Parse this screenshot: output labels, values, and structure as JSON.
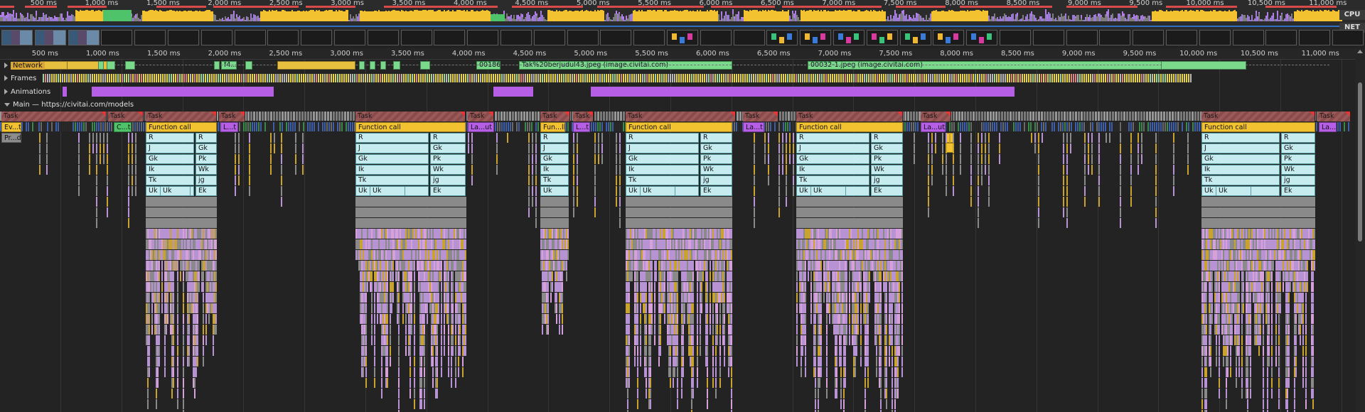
{
  "overview": {
    "ticks": [
      "500 ms",
      "1,000 ms",
      "1,500 ms",
      "2,000 ms",
      "2,500 ms",
      "3,000 ms",
      "3,500 ms",
      "4,000 ms",
      "4,500 ms",
      "5,000 ms",
      "5,500 ms",
      "6,000 ms",
      "6,500 ms",
      "7,000 ms",
      "7,500 ms",
      "8,000 ms",
      "8,500 ms",
      "9,000 ms",
      "9,500 ms",
      "10,000 ms",
      "10,500 ms",
      "11,000 ms"
    ],
    "cpu_label": "CPU",
    "net_label": "NET"
  },
  "timeline": {
    "ticks": [
      "500 ms",
      "1,000 ms",
      "1,500 ms",
      "2,000 ms",
      "2,500 ms",
      "3,000 ms",
      "3,500 ms",
      "4,000 ms",
      "4,500 ms",
      "5,000 ms",
      "5,500 ms",
      "6,000 ms",
      "6,500 ms",
      "7,000 ms",
      "7,500 ms",
      "8,000 ms",
      "8,500 ms",
      "9,000 ms",
      "9,500 ms",
      "10,000 ms",
      "10,500 ms",
      "11,000 ms"
    ]
  },
  "tracks": {
    "network": "Network",
    "frames": "Frames",
    "animations": "Animations",
    "main": "Main — https://civitai.com/models"
  },
  "network_requests": [
    {
      "label": "f4..."
    },
    {
      "label": "00186-"
    },
    {
      "label": "Tak%20berjudul43.jpeg (image.civitai.com)"
    },
    {
      "label": "00032-1.jpeg (image.civitai.com)"
    }
  ],
  "task_label": "Task",
  "tasks": [
    {
      "label": "Task"
    },
    {
      "label": "Task"
    },
    {
      "label": "Task"
    },
    {
      "label": "Task"
    },
    {
      "label": "Task"
    },
    {
      "label": "Task"
    },
    {
      "label": "Task"
    },
    {
      "label": "Task"
    },
    {
      "label": "Task"
    },
    {
      "label": "Task"
    },
    {
      "label": "Task"
    },
    {
      "label": "Task"
    },
    {
      "label": "Task"
    },
    {
      "label": "Task"
    }
  ],
  "level1": [
    {
      "label": "Ev...t"
    },
    {
      "label": "C...t"
    },
    {
      "label": "Function call"
    },
    {
      "label": "L...t"
    },
    {
      "label": "Function call"
    },
    {
      "label": "La...ut"
    },
    {
      "label": "Fun...ll"
    },
    {
      "label": "L...t"
    },
    {
      "label": "Function call"
    },
    {
      "label": "La...t"
    },
    {
      "label": "Function call"
    },
    {
      "label": "La...ut"
    },
    {
      "label": "Function call"
    },
    {
      "label": "La...t"
    }
  ],
  "level2_left": "Pr...d",
  "stack_main": [
    "R",
    "J",
    "Gk",
    "Ik",
    "Tk",
    "Uk"
  ],
  "stack_side_a": [
    "R",
    "Gk",
    "Pk",
    "Wk",
    "jg",
    "Ek",
    "Ik",
    "Tk",
    "Uk"
  ],
  "stack_side_b": [
    "R",
    "Gk",
    "Pk",
    "Wk",
    "jg",
    "Ek",
    "Ik",
    "Tk"
  ],
  "stack_uk2": "Uk"
}
